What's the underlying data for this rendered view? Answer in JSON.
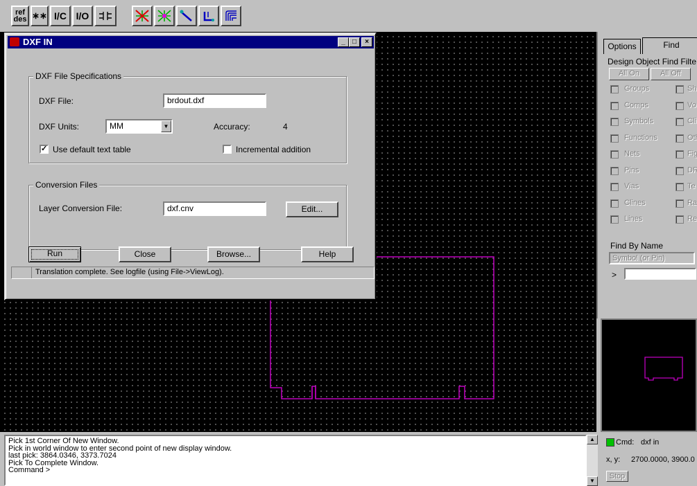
{
  "toolbar": {
    "buttons": [
      {
        "label": "ref\ndes",
        "name": "ref-des-button"
      },
      {
        "label": "∗∗",
        "name": "asterisk-button"
      },
      {
        "label": "I/C",
        "name": "ic-button"
      },
      {
        "label": "I/O",
        "name": "io-button"
      }
    ]
  },
  "dialog": {
    "title": "DXF IN",
    "spec_group": "DXF File Specifications",
    "dxf_file_label": "DXF File:",
    "dxf_file_value": "brdout.dxf",
    "dxf_units_label": "DXF Units:",
    "dxf_units_value": "MM",
    "accuracy_label": "Accuracy:",
    "accuracy_value": "4",
    "use_default_label": "Use default text table",
    "use_default_checked": true,
    "incremental_label": "Incremental addition",
    "incremental_checked": false,
    "conv_group": "Conversion Files",
    "layer_conv_label": "Layer Conversion File:",
    "layer_conv_value": "dxf.cnv",
    "edit_label": "Edit...",
    "run_label": "Run",
    "close_label": "Close",
    "browse_label": "Browse...",
    "help_label": "Help",
    "status": "Translation complete. See logfile (using File->ViewLog)."
  },
  "panel": {
    "tab_options": "Options",
    "tab_find": "Find",
    "filter_title": "Design Object Find Filte",
    "all_on": "All On",
    "all_off": "All Off",
    "left_items": [
      "Groups",
      "Comps",
      "Symbols",
      "Functions",
      "Nets",
      "Pins",
      "Vias",
      "Clines",
      "Lines"
    ],
    "right_items": [
      "Sh",
      "Vo",
      "Cli",
      "Oth",
      "Fig",
      "DR",
      "Te",
      "Ra",
      "Re"
    ],
    "find_by_name": "Find By Name",
    "symbol_select": "Symbol (or Pin)",
    "name_prompt": ">"
  },
  "console": {
    "lines": [
      "Pick 1st Corner Of New Window.",
      "Pick in world window to enter second point of new display window.",
      "last pick:  3864.0346, 3373.7024",
      "Pick To Complete Window.",
      "Command >"
    ]
  },
  "status": {
    "cmd_label": "Cmd:",
    "cmd_value": "dxf in",
    "xy_label": "x, y:",
    "xy_value": "2700.0000, 3900.0",
    "stop_label": "Stop",
    "cmd_indicator_color": "#00c000"
  },
  "colors": {
    "outline": "#c000c0",
    "titlebar": "#000080"
  }
}
